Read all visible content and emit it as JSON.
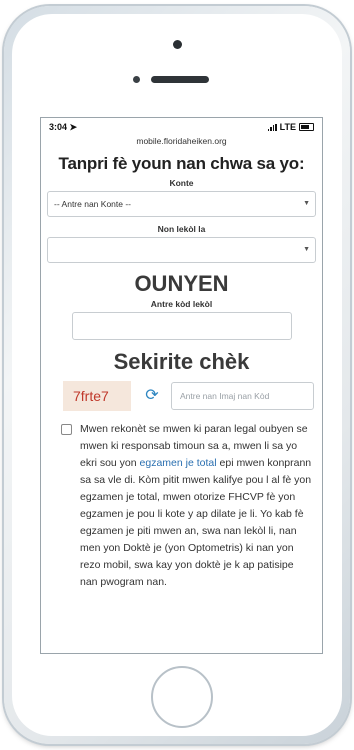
{
  "status": {
    "time": "3:04",
    "network": "LTE"
  },
  "browser": {
    "url": "mobile.floridaheiken.org"
  },
  "form": {
    "heading": "Tanpri fè youn nan chwa sa yo:",
    "county_label": "Konte",
    "county_value": "-- Antre nan Konte --",
    "school_label": "Non lekòl la",
    "school_value": "",
    "or_label": "OUNYEN",
    "school_code_label": "Antre kòd lekòl",
    "security_heading": "Sekirite chèk",
    "captcha_text": "7frte7",
    "captcha_placeholder": "Antre nan Imaj nan Kòd",
    "consent_before": "Mwen rekonèt se mwen ki paran legal oubyen se mwen ki responsab timoun sa a, mwen li sa yo ekri sou yon ",
    "consent_link": "egzamen je total",
    "consent_after": " epi mwen konprann sa sa vle di. Kòm pitit mwen kalifye pou l al fè yon egzamen je total, mwen otorize FHCVP fè yon egzamen je pou li kote y ap dilate je li. Yo kab fè egzamen je piti mwen an, swa nan lekòl li, nan men yon Doktè je (yon Optometris) ki nan yon rezo mobil, swa kay yon doktè je k ap patisipe nan pwogram nan."
  },
  "colors": {
    "captcha_text": "#c0392b",
    "link": "#2a6fb0",
    "refresh_icon": "#2e86c1"
  }
}
